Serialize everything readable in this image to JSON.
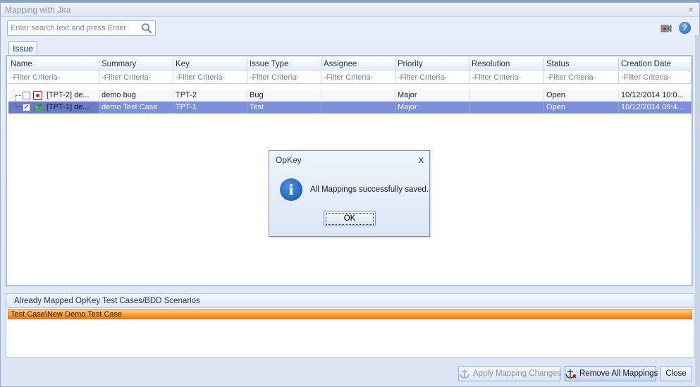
{
  "window": {
    "title": "Mapping with Jira"
  },
  "search": {
    "placeholder": "Enter search text and press Enter"
  },
  "tabs": [
    {
      "label": "Issue"
    }
  ],
  "grid": {
    "columns": [
      "Name",
      "Summary",
      "Key",
      "Issue Type",
      "Assignee",
      "Priority",
      "Resolution",
      "Status",
      "Creation Date"
    ],
    "filter_text": "-Filter Criteria-",
    "rows": [
      {
        "checked": false,
        "icon": "bug-icon",
        "name": "[TPT-2] de...",
        "summary": "demo bug",
        "key": "TPT-2",
        "issue_type": "Bug",
        "assignee": "",
        "priority": "Major",
        "resolution": "",
        "status": "Open",
        "creation_date": "10/12/2014 10:0..."
      },
      {
        "checked": true,
        "icon": "test-icon",
        "name": "[TPT-1] de...",
        "summary": "demo Test Case",
        "key": "TPT-1",
        "issue_type": "Test",
        "assignee": "",
        "priority": "Major",
        "resolution": "",
        "status": "Open",
        "creation_date": "10/12/2014 09:4..."
      }
    ]
  },
  "mapped_section": {
    "title": "Already Mapped OpKey Test Cases/BDD Scenarios",
    "items": [
      "Test Case\\New Demo Test Case"
    ]
  },
  "buttons": {
    "apply": "Apply Mapping Changes",
    "remove_all": "Remove All Mappings",
    "close": "Close"
  },
  "dialog": {
    "title": "OpKey",
    "message": "All Mappings successfully saved.",
    "ok_label": "OK",
    "close_glyph": "x"
  },
  "colors": {
    "selected_row": "#7d8fd9",
    "mapped_item": "#fb9f33",
    "window_bg": "#dfe8f6"
  }
}
